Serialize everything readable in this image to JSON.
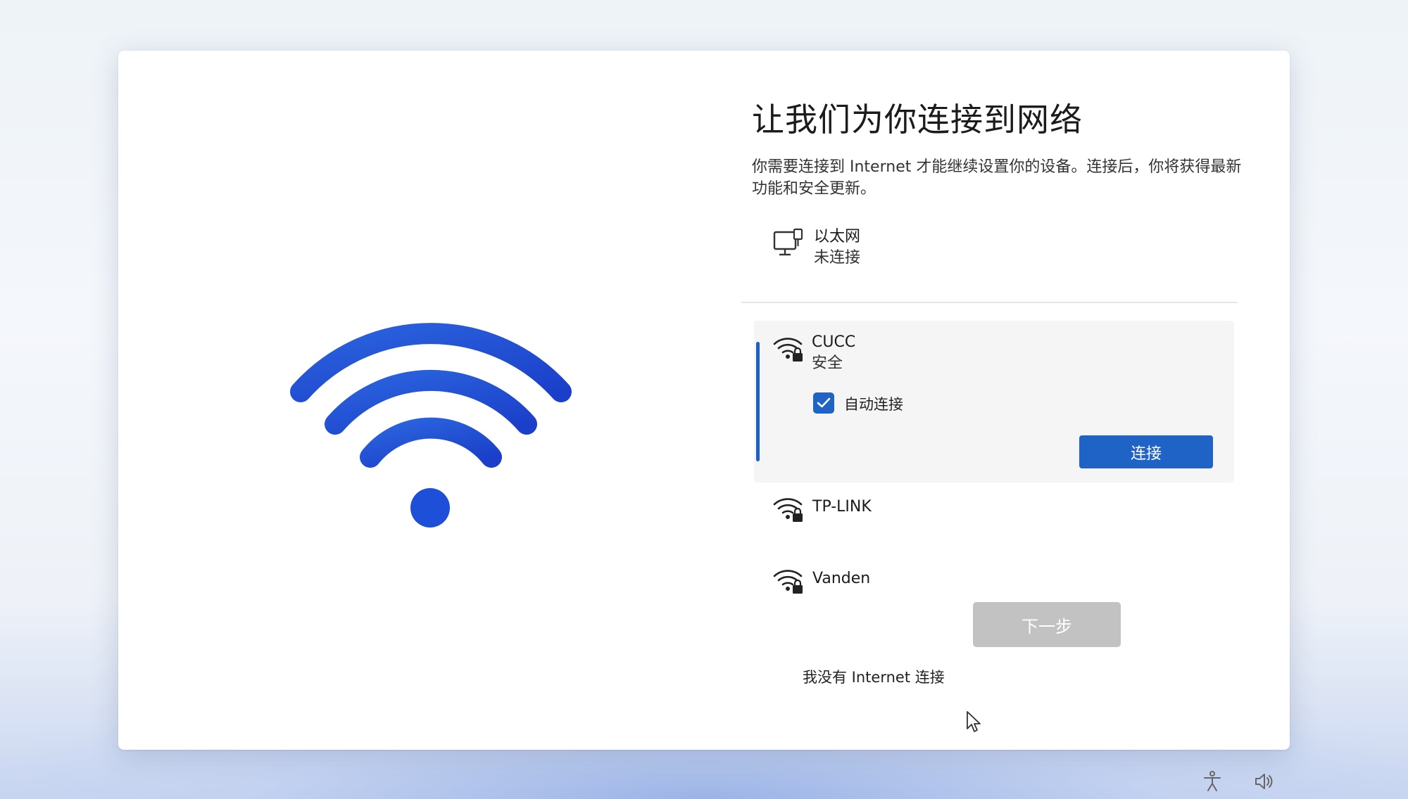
{
  "page": {
    "title": "让我们为你连接到网络",
    "description": "你需要连接到 Internet 才能继续设置你的设备。连接后，你将获得最新功能和安全更新。"
  },
  "ethernet": {
    "icon": "ethernet-monitor-icon",
    "name": "以太网",
    "status": "未连接"
  },
  "networks": [
    {
      "icon": "wifi-secured-icon",
      "name": "CUCC",
      "status": "安全",
      "selected": true
    },
    {
      "icon": "wifi-secured-icon",
      "name": "TP-LINK"
    },
    {
      "icon": "wifi-secured-icon",
      "name": "Vanden"
    }
  ],
  "selected_network": {
    "auto_connect_label": "自动连接",
    "auto_connect_checked": true,
    "connect_label": "连接"
  },
  "footer": {
    "no_internet_label": "我没有 Internet 连接",
    "next_label": "下一步"
  },
  "colors": {
    "accent": "#1f63c7",
    "disabled_button": "#c2c2c2",
    "wifi_illustration": "#1d4fd8"
  },
  "taskbar": {
    "icons": [
      "accessibility-icon",
      "volume-icon"
    ]
  }
}
